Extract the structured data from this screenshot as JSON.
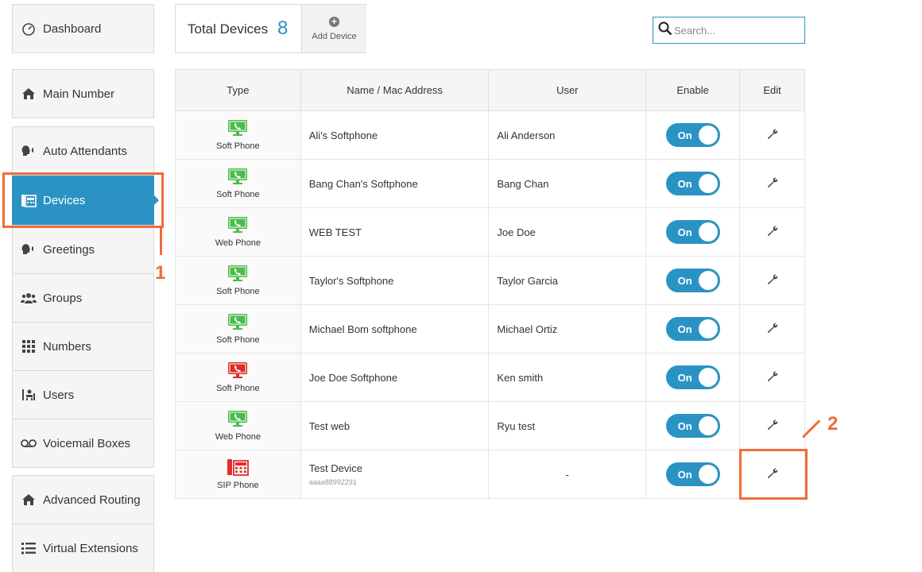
{
  "sidebar": {
    "items": [
      {
        "label": "Dashboard",
        "icon": "speedometer-icon"
      },
      {
        "label": "Main Number",
        "icon": "home-icon"
      },
      {
        "label": "Auto Attendants",
        "icon": "speaker-head-icon"
      },
      {
        "label": "Devices",
        "icon": "desk-phone-icon",
        "active": true
      },
      {
        "label": "Greetings",
        "icon": "speaker-head-icon"
      },
      {
        "label": "Groups",
        "icon": "users-icon"
      },
      {
        "label": "Numbers",
        "icon": "grid-icon"
      },
      {
        "label": "Users",
        "icon": "user-directory-icon"
      },
      {
        "label": "Voicemail Boxes",
        "icon": "voicemail-icon"
      },
      {
        "label": "Advanced Routing",
        "icon": "home-icon"
      },
      {
        "label": "Virtual Extensions",
        "icon": "list-icon"
      }
    ]
  },
  "header": {
    "total_label": "Total Devices",
    "total_count": "8",
    "add_device_label": "Add Device"
  },
  "search": {
    "placeholder": "Search..."
  },
  "table": {
    "columns": [
      "Type",
      "Name / Mac Address",
      "User",
      "Enable",
      "Edit"
    ],
    "rows": [
      {
        "type": "Soft Phone",
        "name": "Ali's Softphone",
        "mac": "",
        "user": "Ali Anderson",
        "enable": "On",
        "icon_color": "#4cbb4c"
      },
      {
        "type": "Soft Phone",
        "name": "Bang Chan's Softphone",
        "mac": "",
        "user": "Bang Chan",
        "enable": "On",
        "icon_color": "#4cbb4c"
      },
      {
        "type": "Web Phone",
        "name": "WEB TEST",
        "mac": "",
        "user": "Joe Doe",
        "enable": "On",
        "icon_color": "#4cbb4c"
      },
      {
        "type": "Soft Phone",
        "name": "Taylor's Softphone",
        "mac": "",
        "user": "Taylor Garcia",
        "enable": "On",
        "icon_color": "#4cbb4c"
      },
      {
        "type": "Soft Phone",
        "name": "Michael Bom softphone",
        "mac": "",
        "user": "Michael Ortiz",
        "enable": "On",
        "icon_color": "#4cbb4c"
      },
      {
        "type": "Soft Phone",
        "name": "Joe Doe Softphone",
        "mac": "",
        "user": "Ken smith",
        "enable": "On",
        "icon_color": "#e02d2d"
      },
      {
        "type": "Web Phone",
        "name": "Test web",
        "mac": "",
        "user": "Ryu test",
        "enable": "On",
        "icon_color": "#4cbb4c"
      },
      {
        "type": "SIP Phone",
        "name": "Test Device",
        "mac": "aaaa88992291",
        "user": "-",
        "enable": "On",
        "icon_color": "#e02d2d"
      }
    ]
  },
  "annotations": [
    "1",
    "2"
  ],
  "colors": {
    "accent": "#2a93c4",
    "annotation": "#f26b3a",
    "softphone_green": "#4cbb4c",
    "alert_red": "#e02d2d"
  }
}
